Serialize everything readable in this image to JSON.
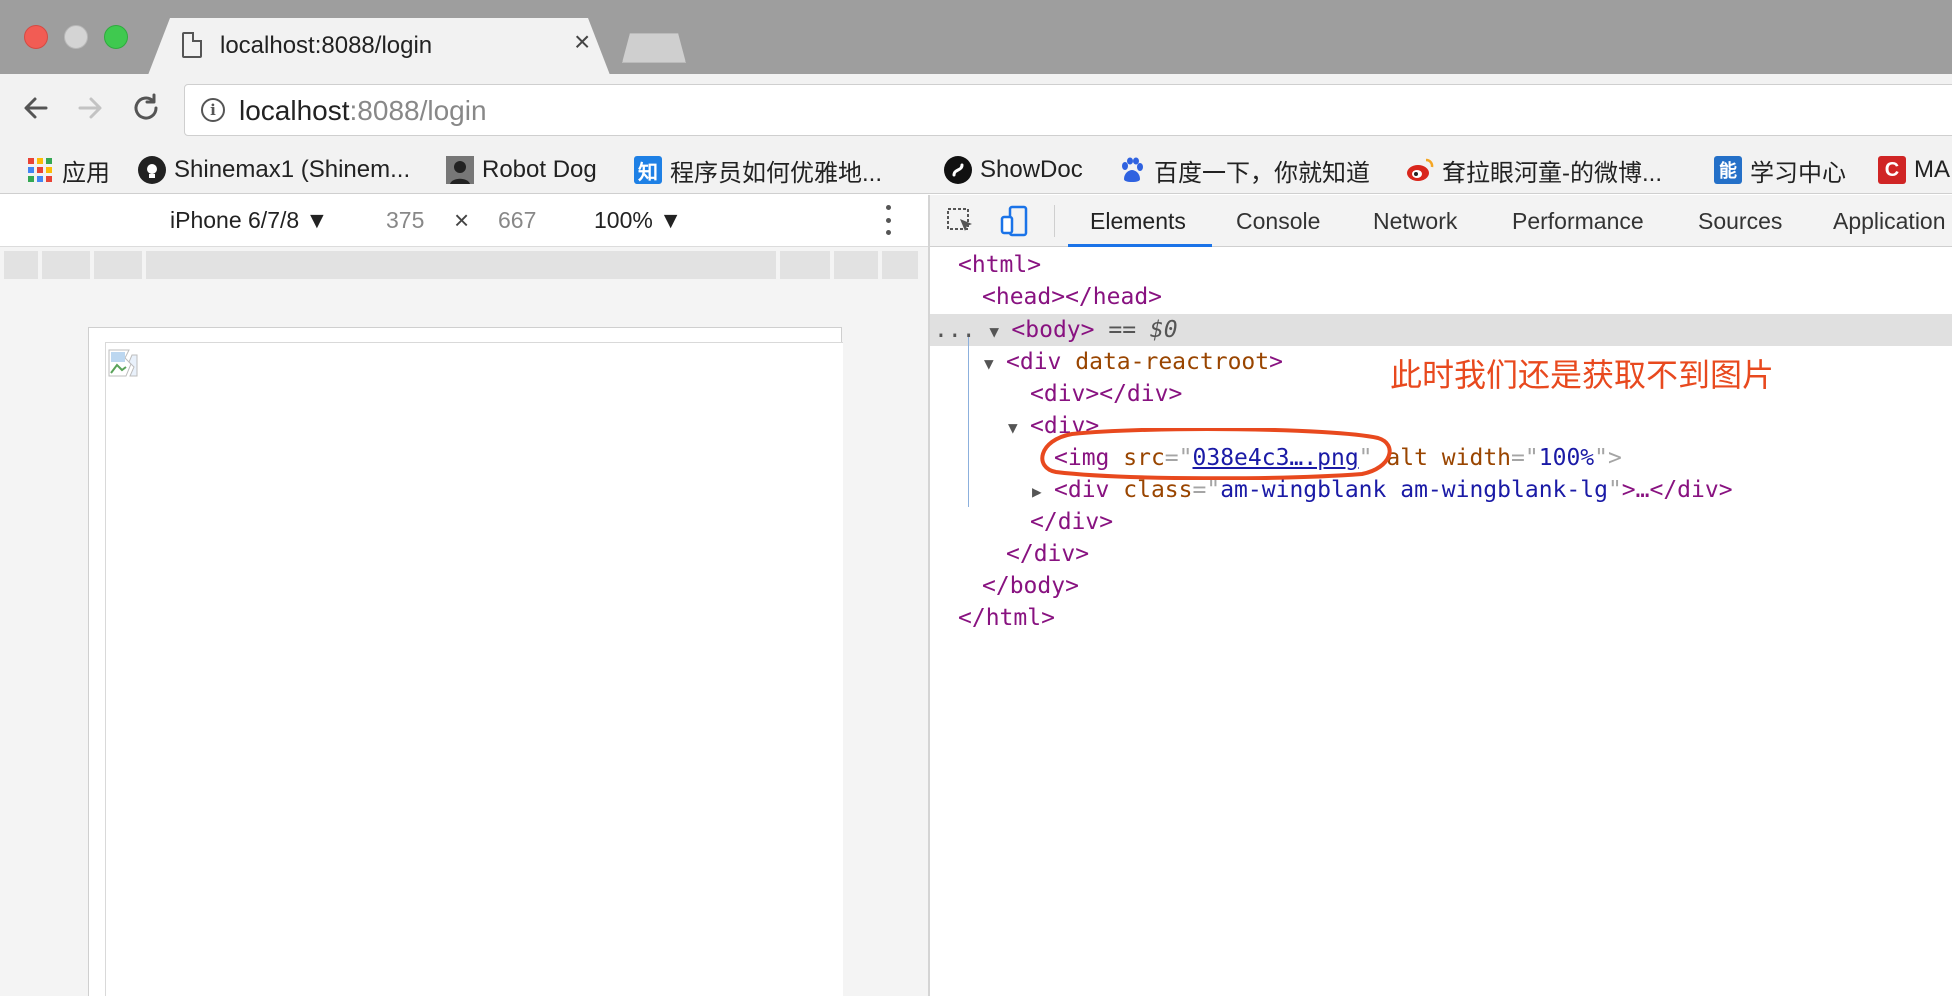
{
  "browser": {
    "tab_title": "localhost:8088/login",
    "tab_close": "×",
    "url_host": "localhost",
    "url_rest": ":8088/login"
  },
  "bookmarks": [
    {
      "label": "应用",
      "icon": "apps-grid-icon"
    },
    {
      "label": "Shinemax1 (Shinem...",
      "icon": "github-icon"
    },
    {
      "label": "Robot Dog",
      "icon": "avatar-icon"
    },
    {
      "label": "程序员如何优雅地...",
      "icon": "zhihu-icon",
      "icon_text": "知"
    },
    {
      "label": "ShowDoc",
      "icon": "showdoc-icon"
    },
    {
      "label": "百度一下，你就知道",
      "icon": "baidu-icon"
    },
    {
      "label": "耷拉眼河童-的微博...",
      "icon": "weibo-icon"
    },
    {
      "label": "学习中心",
      "icon": "neng-icon",
      "icon_text": "能"
    },
    {
      "label": "MA",
      "icon": "ma-icon",
      "icon_text": "C"
    }
  ],
  "device_toolbar": {
    "device": "iPhone 6/7/8 ▼",
    "width": "375",
    "times": "×",
    "height": "667",
    "zoom": "100% ▼"
  },
  "devtools": {
    "tabs": [
      "Elements",
      "Console",
      "Network",
      "Performance",
      "Sources",
      "Application"
    ],
    "active_tab": "Elements",
    "accent_color": "#1a73e8"
  },
  "dom": {
    "html_open": "<html>",
    "head": "<head></head>",
    "body_open": "<body>",
    "body_eq": "== $0",
    "div_root_tag": "<div",
    "div_root_attr": "data-reactroot",
    "div_root_close": ">",
    "div_empty": "<div></div>",
    "div_open": "<div>",
    "img_tag": "<img",
    "img_src_attr": "src",
    "img_src_val": "038e4c3….png",
    "img_alt_attr": "alt",
    "img_width_attr": "width",
    "img_width_val": "100%",
    "wing_tag": "<div",
    "wing_class_attr": "class",
    "wing_class_val": "am-wingblank am-wingblank-lg",
    "wing_close": ">…</div>",
    "div_close_inner": "</div>",
    "div_close_outer": "</div>",
    "body_close": "</body>",
    "html_close": "</html>",
    "dots": "..."
  },
  "annotation": {
    "text": "此时我们还是获取不到图片",
    "color": "#e8491e"
  }
}
